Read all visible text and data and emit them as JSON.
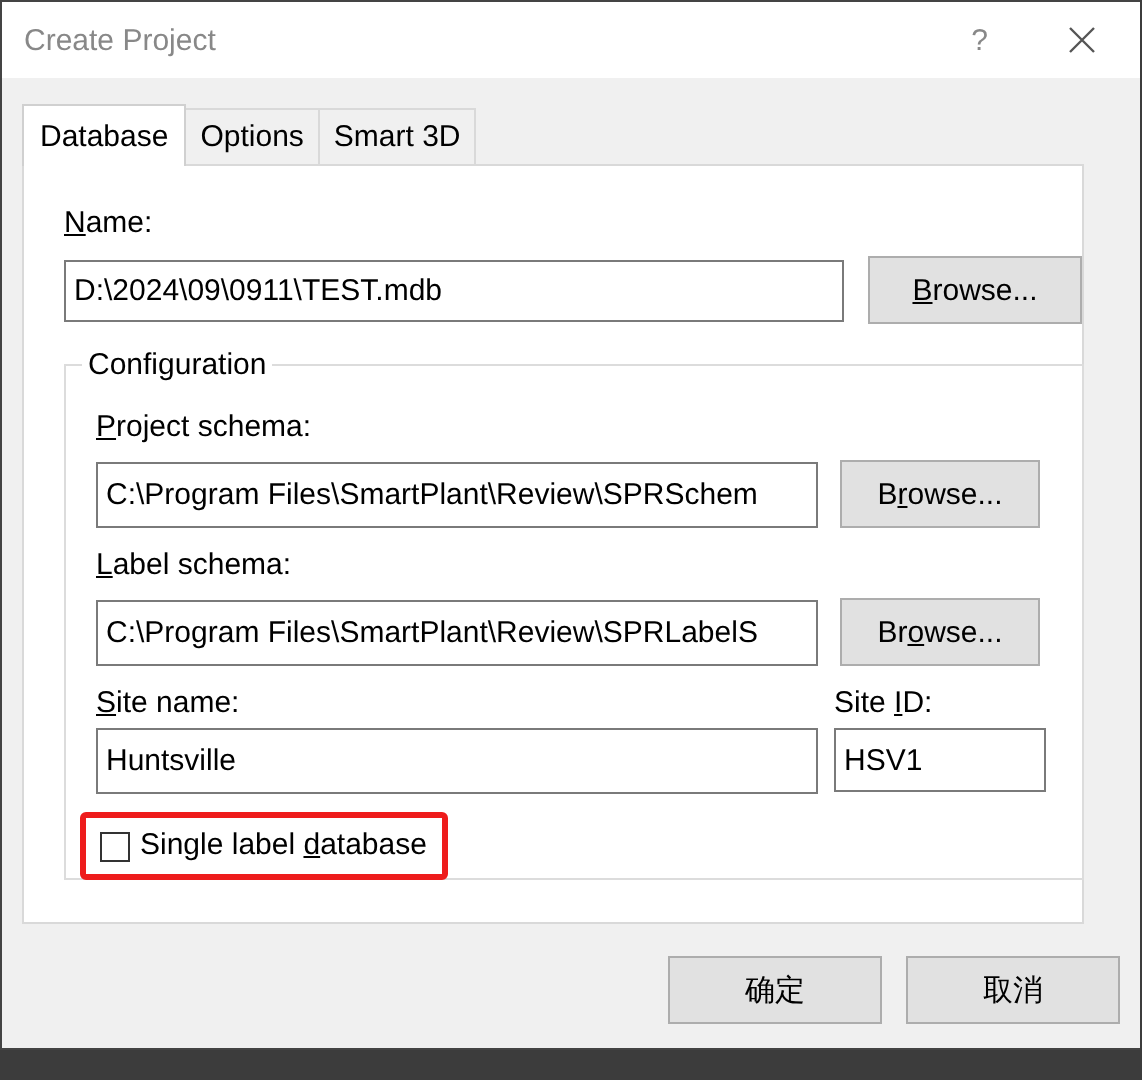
{
  "window": {
    "title": "Create Project",
    "help": "?"
  },
  "tabs": [
    {
      "label": "Database",
      "selected": true
    },
    {
      "label": "Options",
      "selected": false
    },
    {
      "label": "Smart 3D",
      "selected": false
    }
  ],
  "name": {
    "label": {
      "key": "N",
      "post": "ame:"
    },
    "value": "D:\\2024\\09\\0911\\TEST.mdb",
    "browse": {
      "key": "B",
      "post": "rowse..."
    }
  },
  "configuration": {
    "title": "Configuration",
    "fields": [
      {
        "label": {
          "key": "P",
          "post": "roject schema:"
        },
        "value": "C:\\Program Files\\SmartPlant\\Review\\SPRSchem",
        "browse": {
          "pre": "B",
          "key": "r",
          "post": "owse..."
        }
      },
      {
        "label": {
          "key": "L",
          "post": "abel schema:"
        },
        "value": "C:\\Program Files\\SmartPlant\\Review\\SPRLabelS",
        "browse": {
          "pre": "Br",
          "key": "o",
          "post": "wse..."
        }
      }
    ],
    "site_name": {
      "label": {
        "key": "S",
        "post": "ite name:"
      },
      "value": "Huntsville"
    },
    "site_id": {
      "label": {
        "pre": "Site ",
        "key": "I",
        "post": "D:"
      },
      "value": "HSV1"
    },
    "single_label": {
      "label": {
        "pre": "Single label ",
        "key": "d",
        "post": "atabase"
      },
      "checked": false,
      "highlighted": true
    }
  },
  "buttons": [
    "确定",
    "取消"
  ]
}
